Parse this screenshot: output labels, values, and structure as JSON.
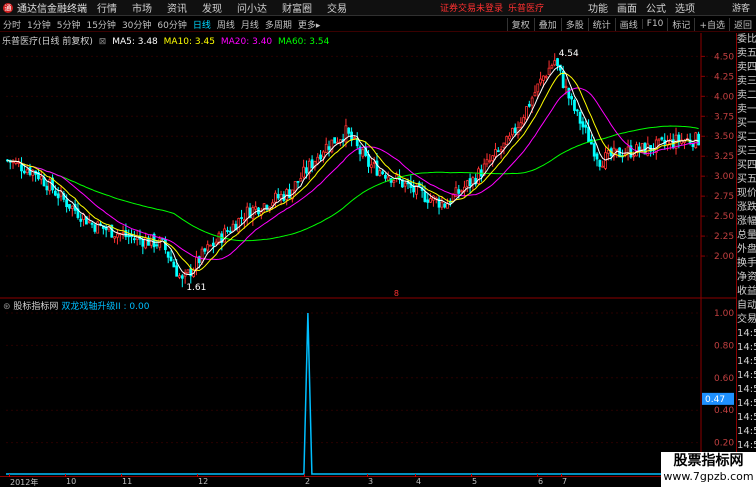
{
  "menubar": {
    "logo_glyph": "通",
    "app_title": "通达信金融终端",
    "menus": [
      "行情",
      "市场",
      "资讯",
      "发现",
      "问小达",
      "财富圈",
      "交易"
    ],
    "status": "证券交易未登录",
    "stock_name": "乐普医疗",
    "right_menus": [
      "功能",
      "画面",
      "公式",
      "选项"
    ],
    "user": "游客"
  },
  "toolbar": {
    "periods": [
      "分时",
      "1分钟",
      "5分钟",
      "15分钟",
      "30分钟",
      "60分钟",
      "日线",
      "周线",
      "月线",
      "多周期",
      "更多"
    ],
    "active_period": "日线",
    "more_suffix": "▸",
    "tools": [
      "复权",
      "叠加",
      "多股",
      "统计",
      "画线",
      "F10",
      "标记",
      "+自选",
      "返回"
    ]
  },
  "info": {
    "title": "乐普医疗(日线 前复权)",
    "ma5": "MA5: 3.48",
    "ma10": "MA10: 3.45",
    "ma20": "MA20: 3.40",
    "ma60": "MA60: 3.54"
  },
  "colors": {
    "up": "#ff3232",
    "down": "#00ffff",
    "ma5": "#ffffff",
    "ma10": "#ffff00",
    "ma20": "#ff00ff",
    "ma60": "#00ff00",
    "indicator": "#00bfff",
    "axis": "#8b0000"
  },
  "chart_data": {
    "type": "candlestick",
    "price_axis": {
      "ticks": [
        "4.50",
        "4.25",
        "4.00",
        "3.75",
        "3.50",
        "3.25",
        "3.00",
        "2.75",
        "2.50",
        "2.25",
        "2.00"
      ],
      "range": [
        1.55,
        4.68
      ]
    },
    "max_label": "4.54",
    "min_label": "1.61",
    "marker": "8",
    "dates": [
      "2012年",
      "10",
      "11",
      "12",
      "2",
      "3",
      "4",
      "5",
      "6",
      "7"
    ],
    "ma_values": {
      "ma5": 3.48,
      "ma10": 3.45,
      "ma20": 3.4,
      "ma60": 3.54
    },
    "anchors": [
      [
        0,
        3.2
      ],
      [
        10,
        3.05
      ],
      [
        20,
        2.7
      ],
      [
        30,
        2.4
      ],
      [
        42,
        2.25
      ],
      [
        55,
        2.15
      ],
      [
        62,
        1.68
      ],
      [
        70,
        2.05
      ],
      [
        85,
        2.55
      ],
      [
        100,
        2.8
      ],
      [
        112,
        3.35
      ],
      [
        120,
        3.55
      ],
      [
        128,
        3.15
      ],
      [
        136,
        3.0
      ],
      [
        145,
        2.8
      ],
      [
        155,
        2.65
      ],
      [
        165,
        2.95
      ],
      [
        178,
        3.45
      ],
      [
        190,
        4.25
      ],
      [
        194,
        4.45
      ],
      [
        200,
        3.9
      ],
      [
        210,
        3.2
      ],
      [
        218,
        3.3
      ],
      [
        228,
        3.35
      ],
      [
        238,
        3.45
      ],
      [
        245,
        3.46
      ]
    ]
  },
  "indicator": {
    "title": "股标指标网",
    "name": "双龙戏轴升级II",
    "value": ": 0.00",
    "axis_ticks": [
      "1.00",
      "0.80",
      "0.60",
      "0.40",
      "0.20"
    ],
    "current": "0.47",
    "spike_x": 0.435,
    "spike_value": 1.0
  },
  "side_panel": {
    "items": [
      "委比",
      "卖五",
      "卖四",
      "卖三",
      "卖二",
      "卖一",
      "买一",
      "买二",
      "买三",
      "买四",
      "买五",
      "现价",
      "涨跌",
      "涨幅",
      "总量",
      "外盘",
      "换手",
      "净资",
      "收益",
      "自动",
      "交易",
      "14:50",
      "14:50",
      "14:50",
      "14:50",
      "14:50",
      "14:50",
      "14:50",
      "14:50",
      "14:50",
      "14:50"
    ]
  },
  "watermark": {
    "title": "股票指标网",
    "url": "www.7gpzb.com"
  }
}
